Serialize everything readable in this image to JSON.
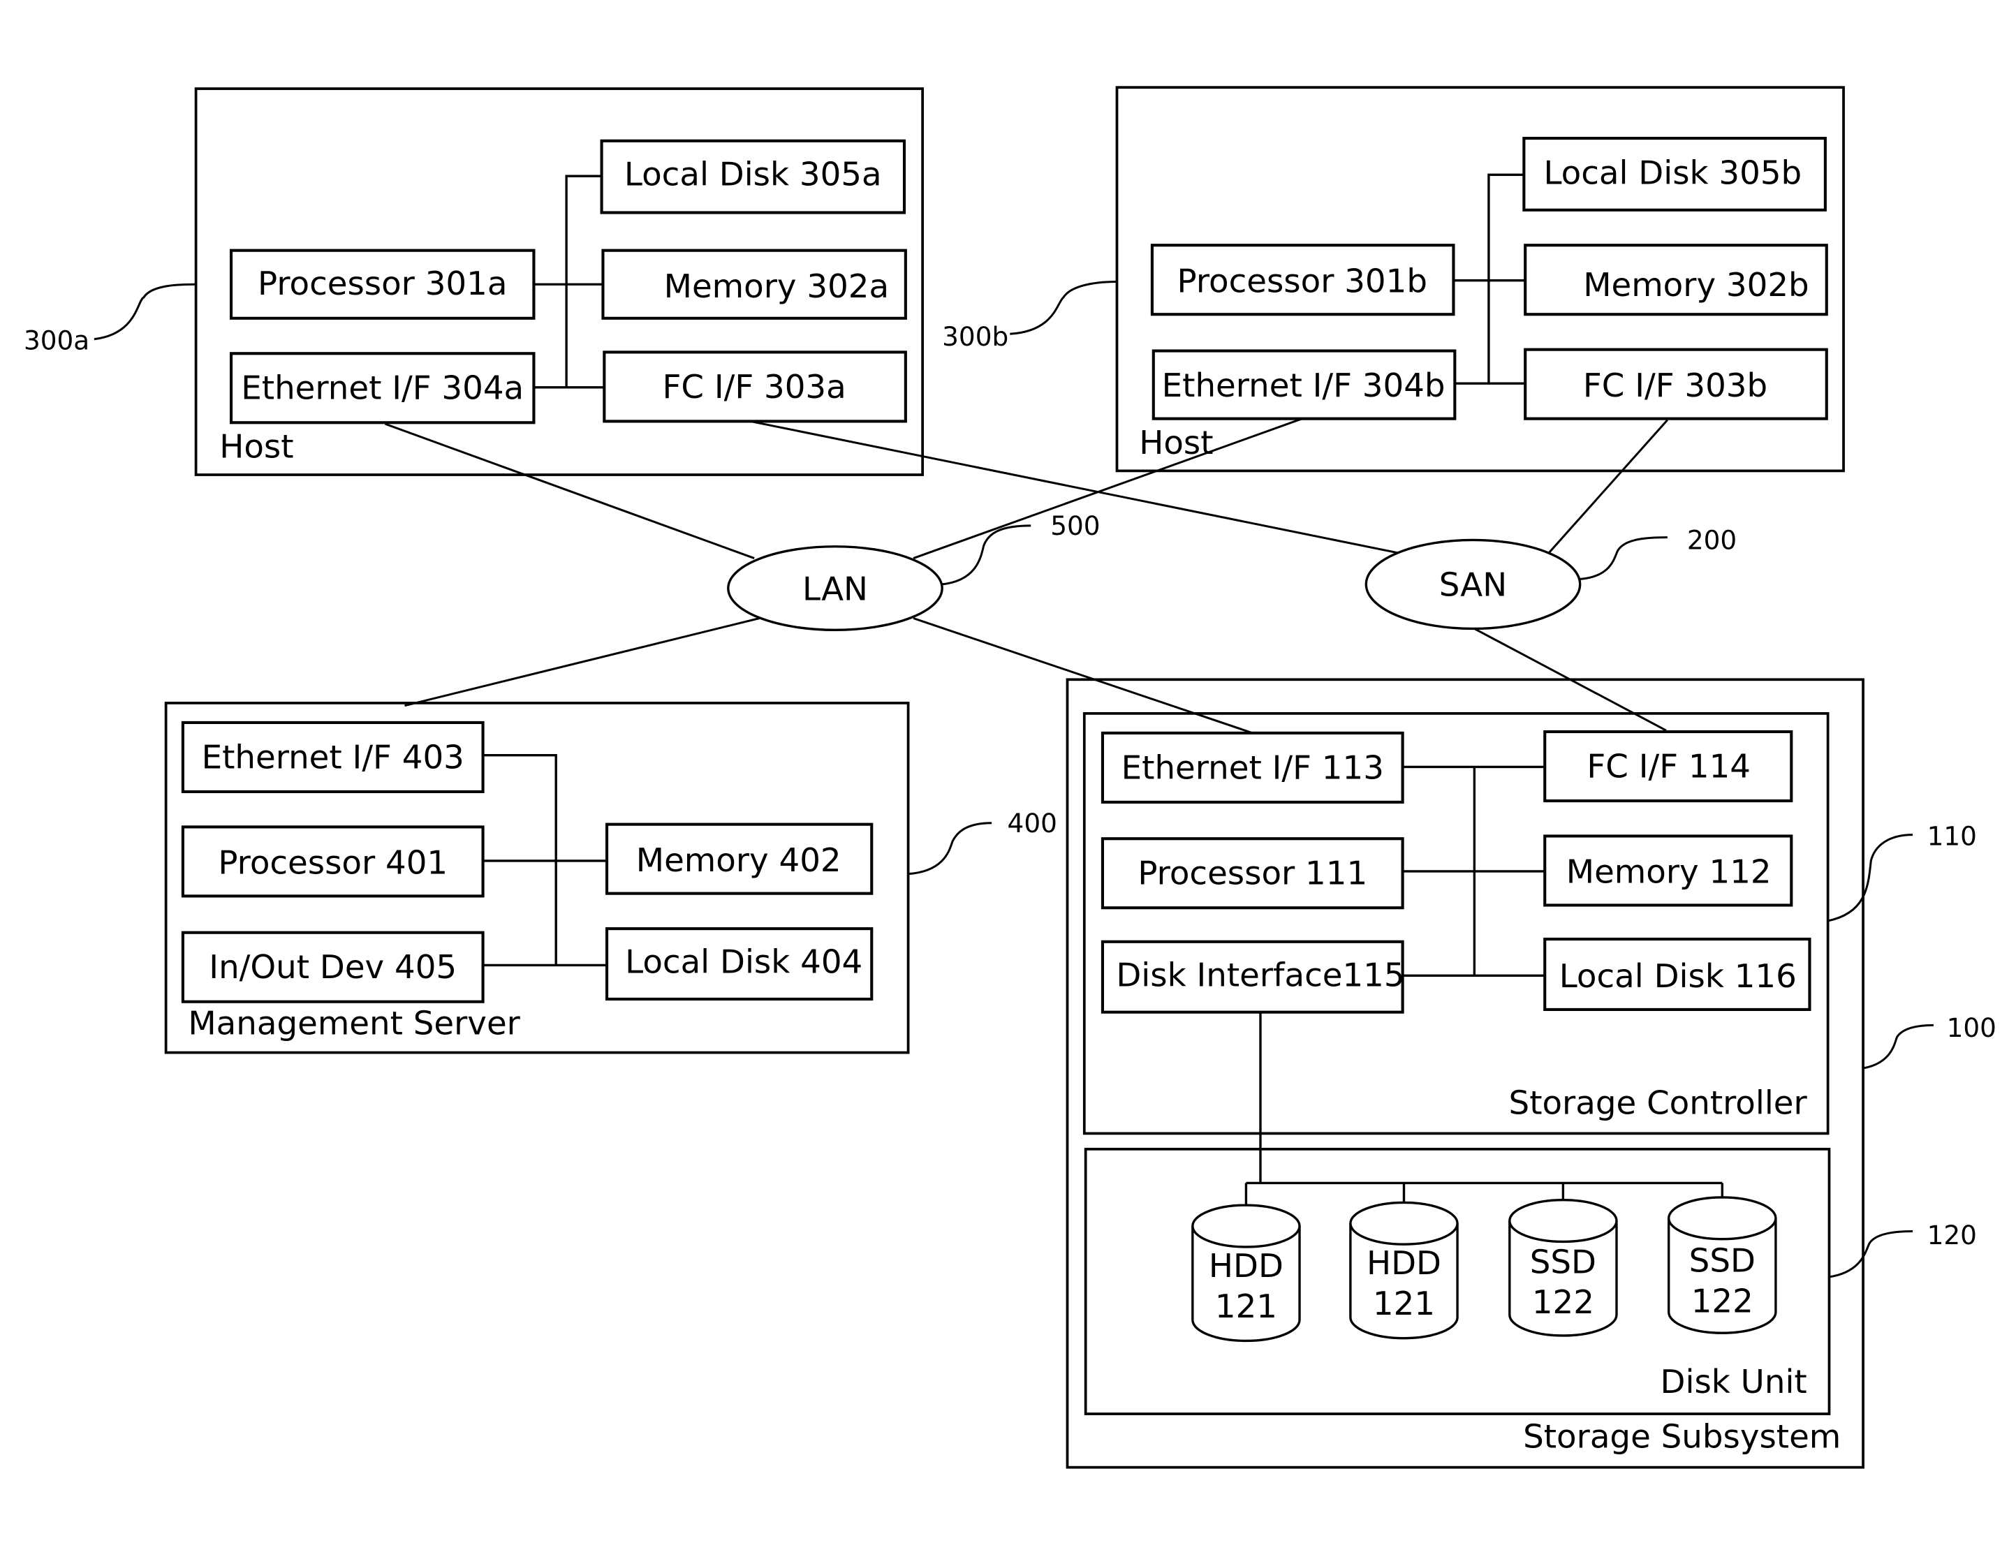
{
  "hosts": [
    {
      "ref": "300a",
      "label": "Host",
      "components": {
        "local_disk": "Local Disk 305a",
        "processor": "Processor 301a",
        "memory": "Memory 302a",
        "ethernet": "Ethernet I/F 304a",
        "fc": "FC I/F 303a"
      }
    },
    {
      "ref": "300b",
      "label": "Host",
      "components": {
        "local_disk": "Local Disk 305b",
        "processor": "Processor 301b",
        "memory": "Memory 302b",
        "ethernet": "Ethernet I/F 304b",
        "fc": "FC I/F 303b"
      }
    }
  ],
  "networks": {
    "lan": {
      "label": "LAN",
      "ref": "500"
    },
    "san": {
      "label": "SAN",
      "ref": "200"
    }
  },
  "management_server": {
    "ref": "400",
    "label": "Management Server",
    "components": {
      "ethernet": "Ethernet I/F 403",
      "processor": "Processor 401",
      "io_dev": "In/Out Dev 405",
      "memory": "Memory 402",
      "local_disk": "Local Disk 404"
    }
  },
  "storage_subsystem": {
    "ref": "100",
    "label": "Storage Subsystem",
    "controller": {
      "ref": "110",
      "label": "Storage Controller",
      "components": {
        "ethernet": "Ethernet I/F 113",
        "fc": "FC I/F 114",
        "processor": "Processor 111",
        "memory": "Memory 112",
        "disk_interface": "Disk Interface115",
        "local_disk": "Local Disk 116"
      }
    },
    "disk_unit": {
      "ref": "120",
      "label": "Disk Unit",
      "drives": [
        {
          "type": "HDD",
          "num": "121"
        },
        {
          "type": "HDD",
          "num": "121"
        },
        {
          "type": "SSD",
          "num": "122"
        },
        {
          "type": "SSD",
          "num": "122"
        }
      ]
    }
  }
}
